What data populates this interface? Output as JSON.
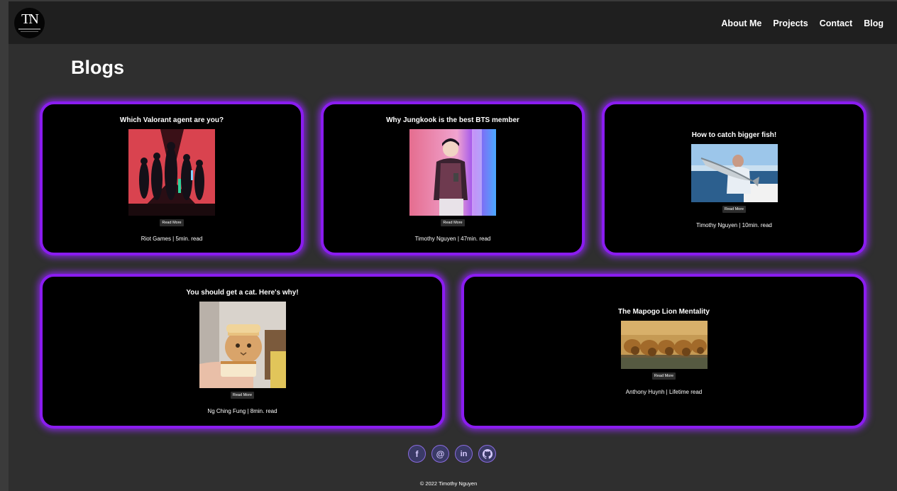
{
  "nav": {
    "logo_text": "TN",
    "links": [
      "About Me",
      "Projects",
      "Contact",
      "Blog"
    ]
  },
  "page": {
    "title": "Blogs"
  },
  "cards": [
    {
      "title": "Which Valorant agent are you?",
      "button": "Read More",
      "meta": "Riot Games | 5min. read",
      "image_icon": "valorant-agents-image"
    },
    {
      "title": "Why Jungkook is the best BTS member",
      "button": "Read More",
      "meta": "Timothy Nguyen | 47min. read",
      "image_icon": "jungkook-photo"
    },
    {
      "title": "How to catch bigger fish!",
      "button": "Read More",
      "meta": "Timothy Nguyen | 10min. read",
      "image_icon": "fishing-photo"
    },
    {
      "title": "You should get a cat. Here's why!",
      "button": "Read More",
      "meta": "Ng Ching Fung | 8min. read",
      "image_icon": "cat-bread-photo"
    },
    {
      "title": "The Mapogo Lion Mentality",
      "button": "Read More",
      "meta": "Anthony Huynh | Lifetime read",
      "image_icon": "lions-drinking-photo"
    }
  ],
  "social": {
    "facebook": "f",
    "email": "@",
    "linkedin": "in",
    "github": "github-icon"
  },
  "footer": {
    "copyright": "© 2022 Timothy Nguyen"
  },
  "colors": {
    "accent": "#8a1cf0",
    "background": "#2f2f2f",
    "nav": "#1f1f1f",
    "card": "#000000"
  }
}
